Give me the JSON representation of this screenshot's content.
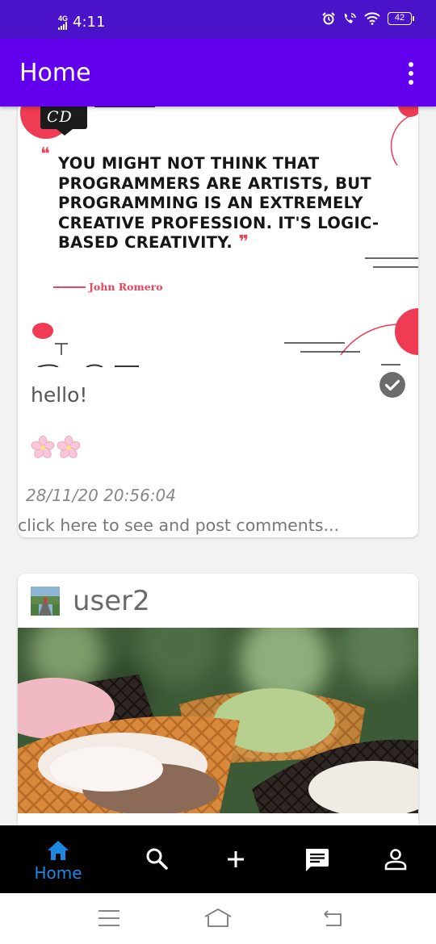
{
  "status_bar": {
    "network": "4G",
    "time": "4:11",
    "battery": "42",
    "icons": [
      "alarm-icon",
      "wifi-call-icon",
      "wifi-icon",
      "battery-icon"
    ]
  },
  "app_bar": {
    "title": "Home",
    "menu_icon": "more-vert-icon"
  },
  "feed": {
    "posts": [
      {
        "image": {
          "badge": "CD",
          "quote": "YOU MIGHT NOT THINK THAT PROGRAMMERS ARE ARTISTS, BUT PROGRAMMING IS AN EXTREMELY CREATIVE PROFESSION. IT'S LOGIC-BASED CREATIVITY.",
          "author": "John Romero"
        },
        "caption": "hello!",
        "timestamp": "28/11/20 20:56:04",
        "comments_link": "click here to see and post comments..."
      },
      {
        "username": "user2",
        "image_subject": "ice cream in waffle cones"
      }
    ]
  },
  "bottom_nav": {
    "items": [
      {
        "icon": "home-icon",
        "label": "Home",
        "active": true
      },
      {
        "icon": "search-icon"
      },
      {
        "icon": "add-icon"
      },
      {
        "icon": "chat-icon"
      },
      {
        "icon": "person-icon"
      }
    ]
  },
  "colors": {
    "status_bar": "#4a12c9",
    "app_bar": "#6200ee",
    "accent": "#1e88e5",
    "quote_accent": "#e8455a"
  }
}
